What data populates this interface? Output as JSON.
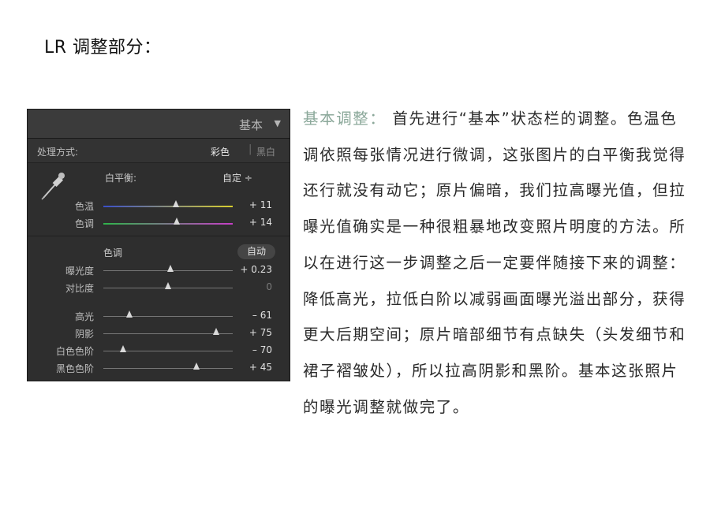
{
  "heading": "LR 调整部分：",
  "panel": {
    "title": "基本",
    "collapse_arrow": "▼",
    "process_label": "处理方式:",
    "process_color": "彩色",
    "process_separator": "|",
    "process_bw": "黑白",
    "eyedropper_icon": "eyedropper-icon",
    "wb_label": "白平衡:",
    "wb_value": "自定 ÷",
    "tone_label": "色调",
    "auto_button": "自动",
    "sliders": [
      {
        "label": "色温",
        "value": "+ 11",
        "position": 0.56,
        "track_color": "temp"
      },
      {
        "label": "色调",
        "value": "+ 14",
        "position": 0.57,
        "track_color": "tint"
      },
      {
        "label": "曝光度",
        "value": "+ 0.23",
        "position": 0.52,
        "track_color": "gray"
      },
      {
        "label": "对比度",
        "value": "0",
        "position": 0.5,
        "track_color": "gray"
      },
      {
        "label": "高光",
        "value": "– 61",
        "position": 0.2,
        "track_color": "gray"
      },
      {
        "label": "阴影",
        "value": "+ 75",
        "position": 0.87,
        "track_color": "gray"
      },
      {
        "label": "白色色阶",
        "value": "– 70",
        "position": 0.15,
        "track_color": "gray"
      },
      {
        "label": "黑色色阶",
        "value": "+ 45",
        "position": 0.72,
        "track_color": "gray"
      }
    ]
  },
  "article": {
    "accent_title": "基本调整：",
    "body": "首先进行“基本”状态栏的调整。色温色调依照每张情况进行微调，这张图片的白平衡我觉得还行就没有动它；原片偏暗，我们拉高曝光值，但拉曝光值确实是一种很粗暴地改变照片明度的方法。所以在进行这一步调整之后一定要伴随接下来的调整：降低高光，拉低白阶以减弱画面曝光溢出部分，获得更大后期空间；原片暗部细节有点缺失（头发细节和裙子褶皱处），所以拉高阴影和黑阶。基本这张照片的曝光调整就做完了。"
  },
  "colors": {
    "panel_bg": "#2e2e2e",
    "accent_title": "#8ba89a",
    "temp_gradient": [
      "#3a4fc9",
      "#d9cf2e"
    ],
    "tint_gradient": [
      "#2fb34a",
      "#c63ec7"
    ]
  }
}
